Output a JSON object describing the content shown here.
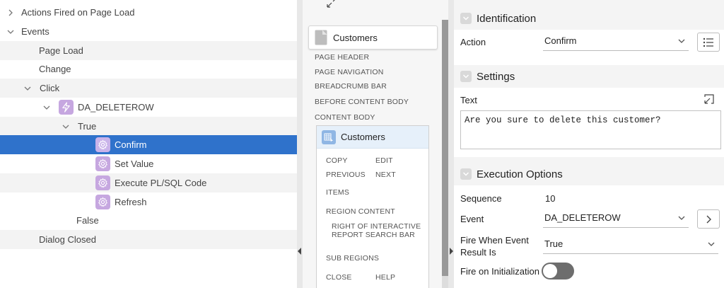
{
  "tree": {
    "rows": [
      {
        "label": "Actions Fired on Page Load"
      },
      {
        "label": "Events"
      },
      {
        "label": "Page Load"
      },
      {
        "label": "Change"
      },
      {
        "label": "Click"
      },
      {
        "label": "DA_DELETEROW"
      },
      {
        "label": "True"
      },
      {
        "label": "Confirm"
      },
      {
        "label": "Set Value"
      },
      {
        "label": "Execute PL/SQL Code"
      },
      {
        "label": "Refresh"
      },
      {
        "label": "False"
      },
      {
        "label": "Dialog Closed"
      }
    ],
    "selected_color": "#2f72cb",
    "action_icon_color": "#c6a7e0"
  },
  "layout_panel": {
    "page_title": "Customers",
    "sections": [
      "PAGE HEADER",
      "PAGE NAVIGATION",
      "BREADCRUMB BAR",
      "BEFORE CONTENT BODY",
      "CONTENT BODY"
    ],
    "region": {
      "title": "Customers",
      "copy": "COPY",
      "edit": "EDIT",
      "previous": "PREVIOUS",
      "next": "NEXT",
      "items": "ITEMS",
      "region_content": "REGION CONTENT",
      "right_of_search_1": "RIGHT OF INTERACTIVE",
      "right_of_search_2": "REPORT SEARCH BAR",
      "sub_regions": "SUB REGIONS",
      "close": "CLOSE",
      "help": "HELP"
    }
  },
  "properties": {
    "identification": {
      "heading": "Identification",
      "action_label": "Action",
      "action_value": "Confirm"
    },
    "settings": {
      "heading": "Settings",
      "text_label": "Text",
      "text_value": "Are you sure to delete this customer?"
    },
    "execution": {
      "heading": "Execution Options",
      "sequence_label": "Sequence",
      "sequence_value": "10",
      "event_label": "Event",
      "event_value": "DA_DELETEROW",
      "fire_when_label_1": "Fire When Event",
      "fire_when_label_2": "Result Is",
      "fire_when_value": "True",
      "fire_on_init_label": "Fire on Initialization",
      "fire_on_init": false
    }
  }
}
